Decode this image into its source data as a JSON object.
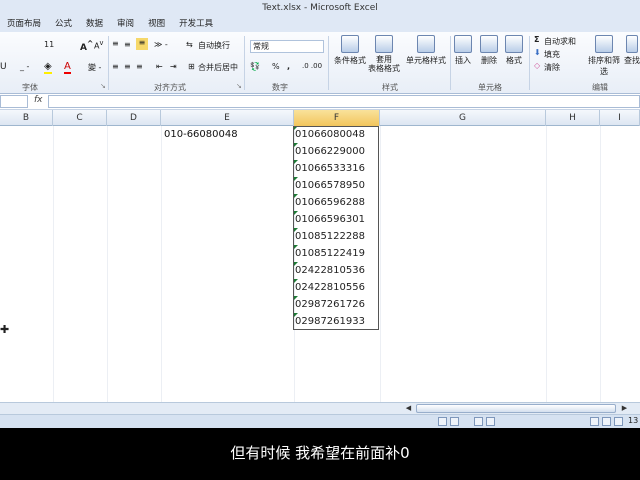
{
  "window": {
    "title": "Text.xlsx - Microsoft Excel"
  },
  "tabs": [
    "页面布局",
    "公式",
    "数据",
    "审阅",
    "视图",
    "开发工具"
  ],
  "ribbon": {
    "font_size": "11",
    "wrap_text": "自动换行",
    "number_format": "常规",
    "merge_center": "合并后居中",
    "percent": "%",
    "comma": ",",
    "dec_inc": ".0 .00",
    "cond_format": "条件格式",
    "table_format": "套用\n表格格式",
    "table_format_l1": "套用",
    "table_format_l2": "表格格式",
    "cell_styles": "单元格样式",
    "insert": "插入",
    "delete": "删除",
    "format": "格式",
    "autosum": "自动求和",
    "fill": "填充",
    "clear": "清除",
    "sort_filter": "排序和筛选",
    "find_select": "查找",
    "groups": {
      "font": "字体",
      "alignment": "对齐方式",
      "number": "数字",
      "styles": "样式",
      "cells": "单元格",
      "editing": "编辑"
    }
  },
  "formula_bar": {
    "name_box": "",
    "fx": "fx",
    "content": ""
  },
  "columns": [
    "B",
    "C",
    "D",
    "E",
    "F",
    "G",
    "H",
    "I"
  ],
  "cells": {
    "E1": "010-66080048",
    "F": [
      "01066080048",
      "01066229000",
      "01066533316",
      "01066578950",
      "01066596288",
      "01066596301",
      "01085122288",
      "01085122419",
      "02422810536",
      "02422810556",
      "02987261726",
      "02987261933"
    ]
  },
  "status": {
    "zoom": "13"
  },
  "subtitle": "但有时候  我希望在前面补0",
  "colors": {
    "ribbon_bg": "#dfe8f5",
    "selected_header": "#f2c55c",
    "text_flag": "#1e7a36",
    "subtitle_bg": "#000000"
  }
}
